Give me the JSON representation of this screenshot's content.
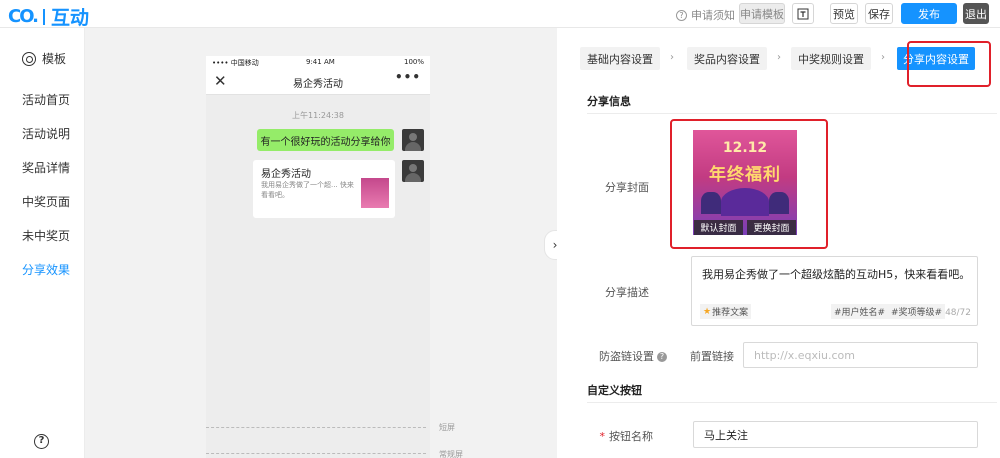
{
  "topbar": {
    "logo_mark": "eqxiu-logo",
    "logo_text": "互动",
    "help_text": "申请须知",
    "apply_template": "申请模板",
    "preview": "预览",
    "save": "保存",
    "publish": "发布",
    "exit": "退出"
  },
  "sidebar": {
    "header": "模板",
    "items": [
      {
        "label": "活动首页"
      },
      {
        "label": "活动说明"
      },
      {
        "label": "奖品详情"
      },
      {
        "label": "中奖页面"
      },
      {
        "label": "未中奖页"
      },
      {
        "label": "分享效果"
      }
    ],
    "active_index": 5
  },
  "phone": {
    "carrier": "•••• 中国移动",
    "time": "9:41 AM",
    "battery": "100%",
    "nav_title": "易企秀活动",
    "close_glyph": "✕",
    "more_glyph": "•••",
    "chat_time": "上午11:24:38",
    "message": "有一个很好玩的活动分享给你",
    "card_title": "易企秀活动",
    "card_desc": "我用易企秀做了一个超... 快来看看吧。",
    "line_short": "短屏",
    "line_normal": "常规屏"
  },
  "steps": [
    {
      "label": "基础内容设置"
    },
    {
      "label": "奖品内容设置"
    },
    {
      "label": "中奖规则设置"
    },
    {
      "label": "分享内容设置"
    }
  ],
  "share": {
    "section_title": "分享信息",
    "cover_label": "分享封面",
    "cover_title_1": "12.12",
    "cover_title_2": "年终福利",
    "default_cover": "默认封面",
    "change_cover": "更换封面",
    "desc_label": "分享描述",
    "desc_value": "我用易企秀做了一个超级炫酷的互动H5，快来看看吧。",
    "tag_recommend": "推荐文案",
    "tag_username": "#用户姓名#",
    "tag_prize": "#奖项等级#",
    "counter": "48/72",
    "anti_theft_label": "防盗链设置",
    "prefix_label": "前置链接",
    "prefix_placeholder": "http://x.eqxiu.com"
  },
  "custom_button": {
    "section_title": "自定义按钮",
    "name_label": "按钮名称",
    "name_value": "马上关注"
  },
  "colors": {
    "accent": "#1593ff",
    "highlight": "#e0202a",
    "chat_green": "#95ec69"
  }
}
